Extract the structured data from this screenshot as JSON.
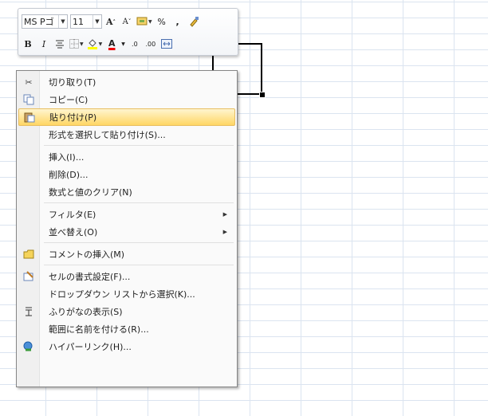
{
  "toolbar": {
    "font_name": "MS Pゴ",
    "font_size": "11",
    "grow_font": "A",
    "shrink_font": "A",
    "percent": "%",
    "comma": ",",
    "bold": "B",
    "italic": "I",
    "font_color": "A",
    "inc_decimal": ".0",
    "dec_decimal": ".00"
  },
  "menu": {
    "items": [
      {
        "label": "切り取り(T)",
        "icon": "scissors-icon"
      },
      {
        "label": "コピー(C)",
        "icon": "copy-icon"
      },
      {
        "label": "貼り付け(P)",
        "icon": "paste-icon",
        "highlighted": true
      },
      {
        "label": "形式を選択して貼り付け(S)..."
      },
      {
        "label": "挿入(I)..."
      },
      {
        "label": "削除(D)..."
      },
      {
        "label": "数式と値のクリア(N)"
      },
      {
        "label": "フィルタ(E)",
        "submenu": true
      },
      {
        "label": "並べ替え(O)",
        "submenu": true
      },
      {
        "label": "コメントの挿入(M)",
        "icon": "comment-icon"
      },
      {
        "label": "セルの書式設定(F)...",
        "icon": "format-cells-icon"
      },
      {
        "label": "ドロップダウン リストから選択(K)..."
      },
      {
        "label": "ふりがなの表示(S)",
        "icon": "furigana-icon"
      },
      {
        "label": "範囲に名前を付ける(R)..."
      },
      {
        "label": "ハイパーリンク(H)...",
        "icon": "hyperlink-icon"
      }
    ]
  },
  "colors": {
    "highlight_fill": "#ffd664",
    "grid_line": "#dbe4f0"
  }
}
